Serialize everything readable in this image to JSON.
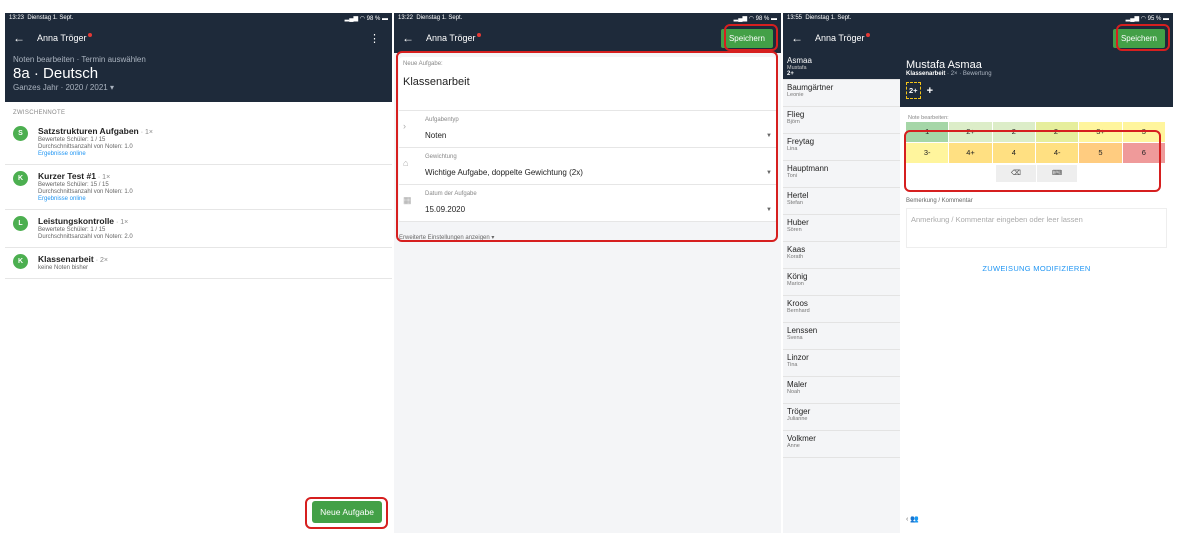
{
  "p1": {
    "status": {
      "time": "13:23",
      "date": "Dienstag 1. Sept.",
      "right": "98 %"
    },
    "user": "Anna Tröger",
    "sub": "Noten bearbeiten · Termin auswählen",
    "title": "8a · Deutsch",
    "year": "Ganzes Jahr · 2020 / 2021 ▾",
    "section": "ZWISCHENNOTE",
    "items": [
      {
        "letter": "S",
        "title": "Satzstrukturen Aufgaben",
        "count": " · 1×",
        "l1": "Bewertete Schüler: 1 / 15",
        "l2": "Durchschnittsanzahl von Noten: 1.0",
        "link": "Ergebnisse online"
      },
      {
        "letter": "K",
        "title": "Kurzer Test #1",
        "count": " · 1×",
        "l1": "Bewertete Schüler: 15 / 15",
        "l2": "Durchschnittsanzahl von Noten: 1.0",
        "link": "Ergebnisse online"
      },
      {
        "letter": "L",
        "title": "Leistungskontrolle",
        "count": " · 1×",
        "l1": "Bewertete Schüler: 1 / 15",
        "l2": "Durchschnittsanzahl von Noten: 2.0"
      },
      {
        "letter": "K",
        "title": "Klassenarbeit",
        "count": " · 2×",
        "l1": "keine Noten bisher"
      }
    ],
    "fab": "Neue Aufgabe"
  },
  "p2": {
    "status": {
      "time": "13:22",
      "date": "Dienstag 1. Sept.",
      "right": "98 %"
    },
    "user": "Anna Tröger",
    "save": "Speichern",
    "new_label": "Neue Aufgabe:",
    "task_title": "Klassenarbeit",
    "fields": [
      {
        "icon": "chevron-right-icon",
        "label": "Aufgabentyp",
        "value": "Noten"
      },
      {
        "icon": "weight-icon",
        "label": "Gewichtung",
        "value": "Wichtige Aufgabe, doppelte Gewichtung (2x)"
      },
      {
        "icon": "calendar-icon",
        "label": "Datum der Aufgabe",
        "value": "15.09.2020"
      }
    ],
    "extra": "Erweiterte Einstellungen anzeigen ▾"
  },
  "p3": {
    "status": {
      "time": "13:55",
      "date": "Dienstag 1. Sept.",
      "right": "95 %"
    },
    "user": "Anna Tröger",
    "save": "Speichern",
    "students": [
      {
        "last": "Asmaa",
        "first": "Mustafa",
        "grade": "2+"
      },
      {
        "last": "Baumgärtner",
        "first": "Leonie"
      },
      {
        "last": "Flieg",
        "first": "Björn"
      },
      {
        "last": "Freytag",
        "first": "Lina"
      },
      {
        "last": "Hauptmann",
        "first": "Toni"
      },
      {
        "last": "Hertel",
        "first": "Stefan"
      },
      {
        "last": "Huber",
        "first": "Sören"
      },
      {
        "last": "Kaas",
        "first": "Korath"
      },
      {
        "last": "König",
        "first": "Marion"
      },
      {
        "last": "Kroos",
        "first": "Bernhard"
      },
      {
        "last": "Lenssen",
        "first": "Svena"
      },
      {
        "last": "Linzor",
        "first": "Tina"
      },
      {
        "last": "Maler",
        "first": "Noah"
      },
      {
        "last": "Tröger",
        "first": "Julianne"
      },
      {
        "last": "Volkmer",
        "first": "Anne"
      }
    ],
    "student_name": "Mustafa Asmaa",
    "task": "Klassenarbeit",
    "task_rest": " · 2× · Bewertung",
    "chip": "2+",
    "plus": "+",
    "grade_label": "Note bearbeiten:",
    "grades": [
      {
        "label": "1",
        "color": "#a5d6a7"
      },
      {
        "label": "2+",
        "color": "#dcedc8"
      },
      {
        "label": "2",
        "color": "#dcedc8"
      },
      {
        "label": "2-",
        "color": "#e6ee9c"
      },
      {
        "label": "3+",
        "color": "#fff59d"
      },
      {
        "label": "3",
        "color": "#fff59d"
      },
      {
        "label": "3-",
        "color": "#fff59d"
      },
      {
        "label": "4+",
        "color": "#ffe082"
      },
      {
        "label": "4",
        "color": "#ffe082"
      },
      {
        "label": "4-",
        "color": "#ffe082"
      },
      {
        "label": "5",
        "color": "#ffcc80"
      },
      {
        "label": "6",
        "color": "#ef9a9a"
      }
    ],
    "bem_label": "Bemerkung / Kommentar",
    "kom_placeholder": "Anmerkung / Kommentar eingeben oder leer lassen",
    "zuweisung": "ZUWEISUNG MODIFIZIEREN"
  }
}
